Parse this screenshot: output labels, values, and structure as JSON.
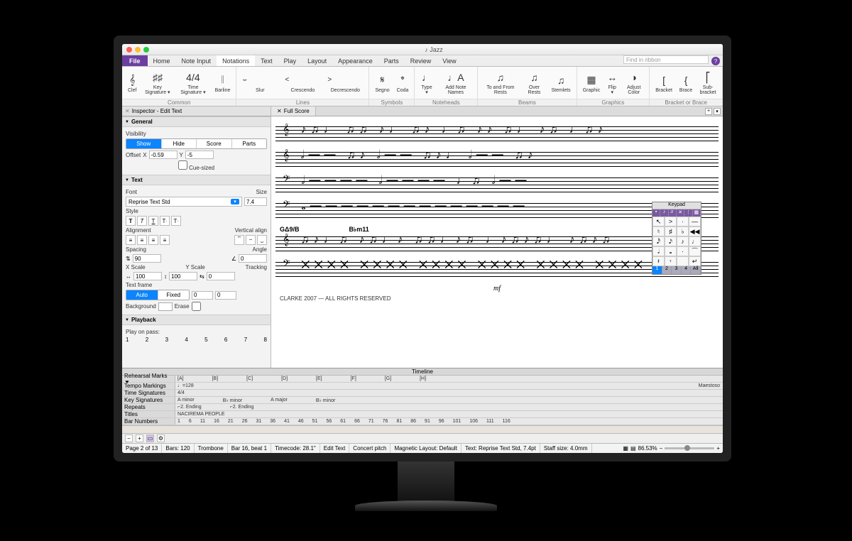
{
  "window": {
    "title": "♪ Jazz"
  },
  "menu": {
    "file": "File",
    "tabs": [
      "Home",
      "Note Input",
      "Notations",
      "Text",
      "Play",
      "Layout",
      "Appearance",
      "Parts",
      "Review",
      "View"
    ],
    "active": "Notations",
    "search_placeholder": "Find in ribbon",
    "help": "?"
  },
  "ribbon": {
    "groups": [
      {
        "label": "Common",
        "items": [
          {
            "name": "clef",
            "label": "Clef",
            "glyph": "𝄞"
          },
          {
            "name": "key-signature",
            "label": "Key\nSignature ▾",
            "glyph": "♯♯"
          },
          {
            "name": "time-signature",
            "label": "Time\nSignature ▾",
            "glyph": "4/4"
          },
          {
            "name": "barline",
            "label": "Barline",
            "glyph": "𝄁"
          }
        ]
      },
      {
        "label": "Lines",
        "items": [
          {
            "name": "slur",
            "label": "Slur",
            "glyph": "⌣",
            "wide": true
          },
          {
            "name": "crescendo",
            "label": "Crescendo",
            "glyph": "<",
            "wide": true
          },
          {
            "name": "decrescendo",
            "label": "Decrescendo",
            "glyph": ">",
            "wide": true
          }
        ]
      },
      {
        "label": "Symbols",
        "items": [
          {
            "name": "segno",
            "label": "Segno",
            "glyph": "𝄋"
          },
          {
            "name": "coda",
            "label": "Coda",
            "glyph": "𝄌"
          }
        ]
      },
      {
        "label": "Noteheads",
        "items": [
          {
            "name": "type",
            "label": "Type\n▾",
            "glyph": "♩"
          },
          {
            "name": "add-note-names",
            "label": "Add Note\nNames",
            "glyph": "♩A"
          }
        ]
      },
      {
        "label": "Beams",
        "items": [
          {
            "name": "to-from-rests",
            "label": "To and\nFrom Rests",
            "glyph": "♫"
          },
          {
            "name": "over-rests",
            "label": "Over\nRests",
            "glyph": "♫"
          },
          {
            "name": "stemlets",
            "label": "Stemlets",
            "glyph": "♫"
          }
        ]
      },
      {
        "label": "Graphics",
        "items": [
          {
            "name": "graphic",
            "label": "Graphic",
            "glyph": "▦"
          },
          {
            "name": "flip",
            "label": "Flip ▾",
            "glyph": "↔"
          },
          {
            "name": "adjust-color",
            "label": "Adjust Color",
            "glyph": "◑"
          }
        ]
      },
      {
        "label": "Bracket or Brace",
        "items": [
          {
            "name": "bracket",
            "label": "Bracket",
            "glyph": "["
          },
          {
            "name": "brace",
            "label": "Brace",
            "glyph": "{"
          },
          {
            "name": "sub-bracket",
            "label": "Sub-bracket",
            "glyph": "⎡"
          }
        ]
      }
    ]
  },
  "doctabs": {
    "inspector_title": "Inspector - Edit Text",
    "score_tab": "Full Score"
  },
  "inspector": {
    "general": {
      "title": "General",
      "visibility_label": "Visibility",
      "visibility_options": [
        "Show",
        "Hide",
        "Score",
        "Parts"
      ],
      "visibility_selected": "Show",
      "offset_label": "Offset",
      "offset_x_label": "X",
      "offset_x": "-0.59",
      "offset_y_label": "Y",
      "offset_y": "-5",
      "cue_sized": "Cue-sized"
    },
    "text": {
      "title": "Text",
      "font_label": "Font",
      "font": "Reprise Text Std",
      "size_label": "Size",
      "size": "7.4",
      "style_label": "Style",
      "alignment_label": "Alignment",
      "vertical_align_label": "Vertical align",
      "spacing_label": "Spacing",
      "spacing": "90",
      "angle_label": "Angle",
      "angle": "0",
      "xscale_label": "X Scale",
      "xscale": "100",
      "yscale_label": "Y Scale",
      "yscale": "100",
      "tracking_label": "Tracking",
      "tracking": "0",
      "text_frame_label": "Text frame",
      "text_frame_options": [
        "Auto",
        "Fixed"
      ],
      "text_frame_selected": "Auto",
      "text_frame_v1": "0",
      "text_frame_v2": "0",
      "background_label": "Background",
      "erase_label": "Erase"
    },
    "playback": {
      "title": "Playback",
      "play_on_pass": "Play on pass:",
      "passes": [
        "1",
        "2",
        "3",
        "4",
        "5",
        "6",
        "7",
        "8"
      ]
    }
  },
  "score": {
    "chord1": "GΔ9/B",
    "chord2": "B♭m11",
    "dynamic": "mf",
    "copyright": "CLARKE 2007 — ALL RIGHTS RESERVED"
  },
  "keypad": {
    "title": "Keypad",
    "bottom": [
      "1",
      "2",
      "3",
      "4",
      "All"
    ],
    "bottom_selected": "1"
  },
  "timeline": {
    "title": "Timeline",
    "rows": {
      "rehearsal_marks": {
        "label": "Rehearsal Marks ▼",
        "marks": [
          "[A]",
          "[B]",
          "[C]",
          "[D]",
          "[E]",
          "[F]",
          "[G]",
          "[H]"
        ]
      },
      "tempo_markings": {
        "label": "Tempo Markings",
        "value": "♩=128",
        "end": "Maestoso"
      },
      "time_signatures": {
        "label": "Time Signatures",
        "value": "4/4"
      },
      "key_signatures": {
        "label": "Key Signatures",
        "values": [
          "A minor",
          "B♭ minor",
          "A major",
          "B♭ minor"
        ]
      },
      "repeats": {
        "label": "Repeats",
        "values": [
          "⌐2. Ending",
          "⌐2. Ending"
        ]
      },
      "titles": {
        "label": "Titles",
        "value": "NACIREMA PEOPLE"
      },
      "bar_numbers": {
        "label": "Bar Numbers",
        "values": [
          "1",
          "6",
          "11",
          "16",
          "21",
          "26",
          "31",
          "36",
          "41",
          "46",
          "51",
          "56",
          "61",
          "66",
          "71",
          "76",
          "81",
          "86",
          "91",
          "96",
          "101",
          "106",
          "111",
          "116"
        ]
      }
    }
  },
  "status": {
    "page": "Page 2 of 13",
    "bars": "Bars: 120",
    "instrument": "Trombone",
    "position": "Bar 16, beat 1",
    "timecode": "Timecode: 28.1\"",
    "mode": "Edit Text",
    "pitch": "Concert pitch",
    "magnetic": "Magnetic Layout: Default",
    "textinfo": "Text: Reprise Text Std, 7.4pt",
    "staffsize": "Staff size: 4.0mm",
    "zoom": "86.53%"
  }
}
